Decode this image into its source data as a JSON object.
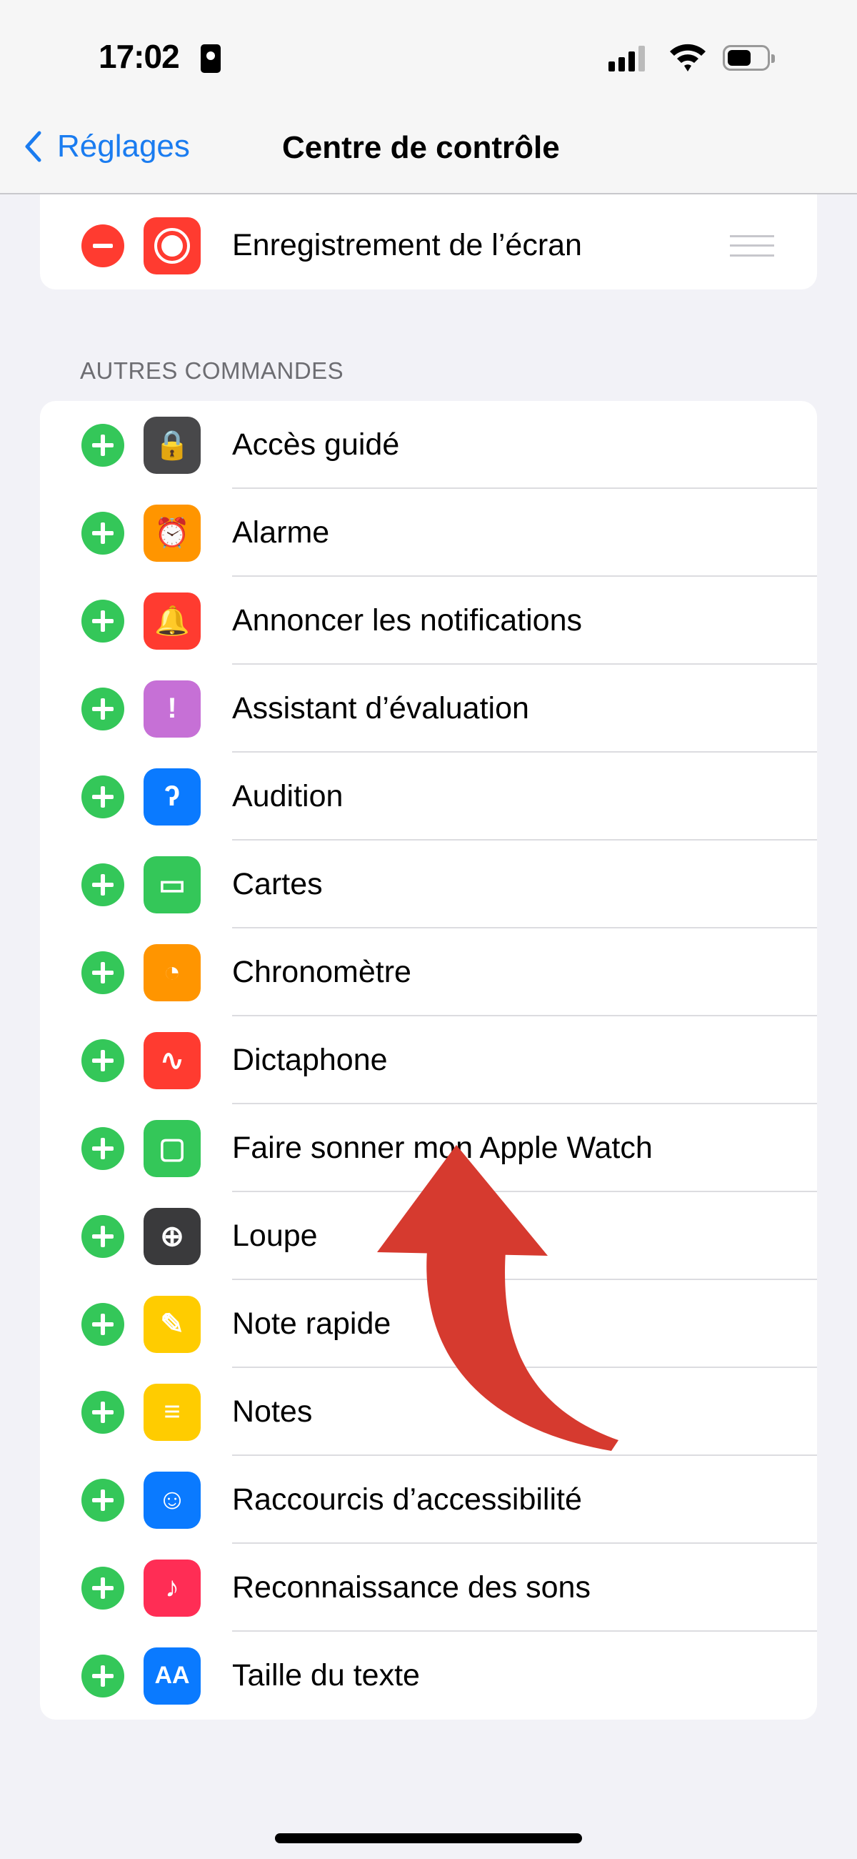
{
  "status_bar": {
    "time": "17:02",
    "icons": [
      "contact-card-icon",
      "cellular-signal-icon",
      "wifi-icon",
      "battery-icon"
    ]
  },
  "nav": {
    "back_label": "Réglages",
    "title": "Centre de contrôle"
  },
  "included": [
    {
      "label": "Enregistrement de l’écran",
      "icon": "screen-recording-icon",
      "color": "#ff3b30"
    }
  ],
  "section_title": "AUTRES COMMANDES",
  "more_controls": [
    {
      "label": "Accès guidé",
      "icon": "guided-access-lock-icon",
      "color": "#48484a"
    },
    {
      "label": "Alarme",
      "icon": "alarm-clock-icon",
      "color": "#ff9500"
    },
    {
      "label": "Annoncer les notifications",
      "icon": "announce-bell-icon",
      "color": "#ff3b30"
    },
    {
      "label": "Assistant d’évaluation",
      "icon": "feedback-bubble-icon",
      "color": "#c670d6"
    },
    {
      "label": "Audition",
      "icon": "ear-icon",
      "color": "#0a7aff"
    },
    {
      "label": "Cartes",
      "icon": "wallet-icon",
      "color": "#34c759"
    },
    {
      "label": "Chronomètre",
      "icon": "stopwatch-icon",
      "color": "#ff9500"
    },
    {
      "label": "Dictaphone",
      "icon": "waveform-icon",
      "color": "#ff3b30"
    },
    {
      "label": "Faire sonner mon Apple Watch",
      "icon": "ping-watch-icon",
      "color": "#34c759"
    },
    {
      "label": "Loupe",
      "icon": "magnifier-icon",
      "color": "#3a3a3c"
    },
    {
      "label": "Note rapide",
      "icon": "quick-note-icon",
      "color": "#ffcc00"
    },
    {
      "label": "Notes",
      "icon": "notes-icon",
      "color": "#ffcc00"
    },
    {
      "label": "Raccourcis d’accessibilité",
      "icon": "accessibility-icon",
      "color": "#0a7aff"
    },
    {
      "label": "Reconnaissance des sons",
      "icon": "sound-recognition-icon",
      "color": "#ff2d55"
    },
    {
      "label": "Taille du texte",
      "icon": "text-size-icon",
      "color": "#0a7aff"
    }
  ],
  "glyphs": {
    "Accès guidé": "🔒",
    "Alarme": "⏰",
    "Annoncer les notifications": "🔔",
    "Assistant d’évaluation": "!",
    "Audition": "ʔ",
    "Cartes": "▭",
    "Chronomètre": "◔",
    "Dictaphone": "∿",
    "Faire sonner mon Apple Watch": "▢",
    "Loupe": "⊕",
    "Note rapide": "✎",
    "Notes": "≡",
    "Raccourcis d’accessibilité": "☺",
    "Reconnaissance des sons": "♪",
    "Taille du texte": "AA"
  },
  "annotation": {
    "type": "arrow",
    "color": "#d63a2f",
    "points_to": "Faire sonner mon Apple Watch"
  }
}
